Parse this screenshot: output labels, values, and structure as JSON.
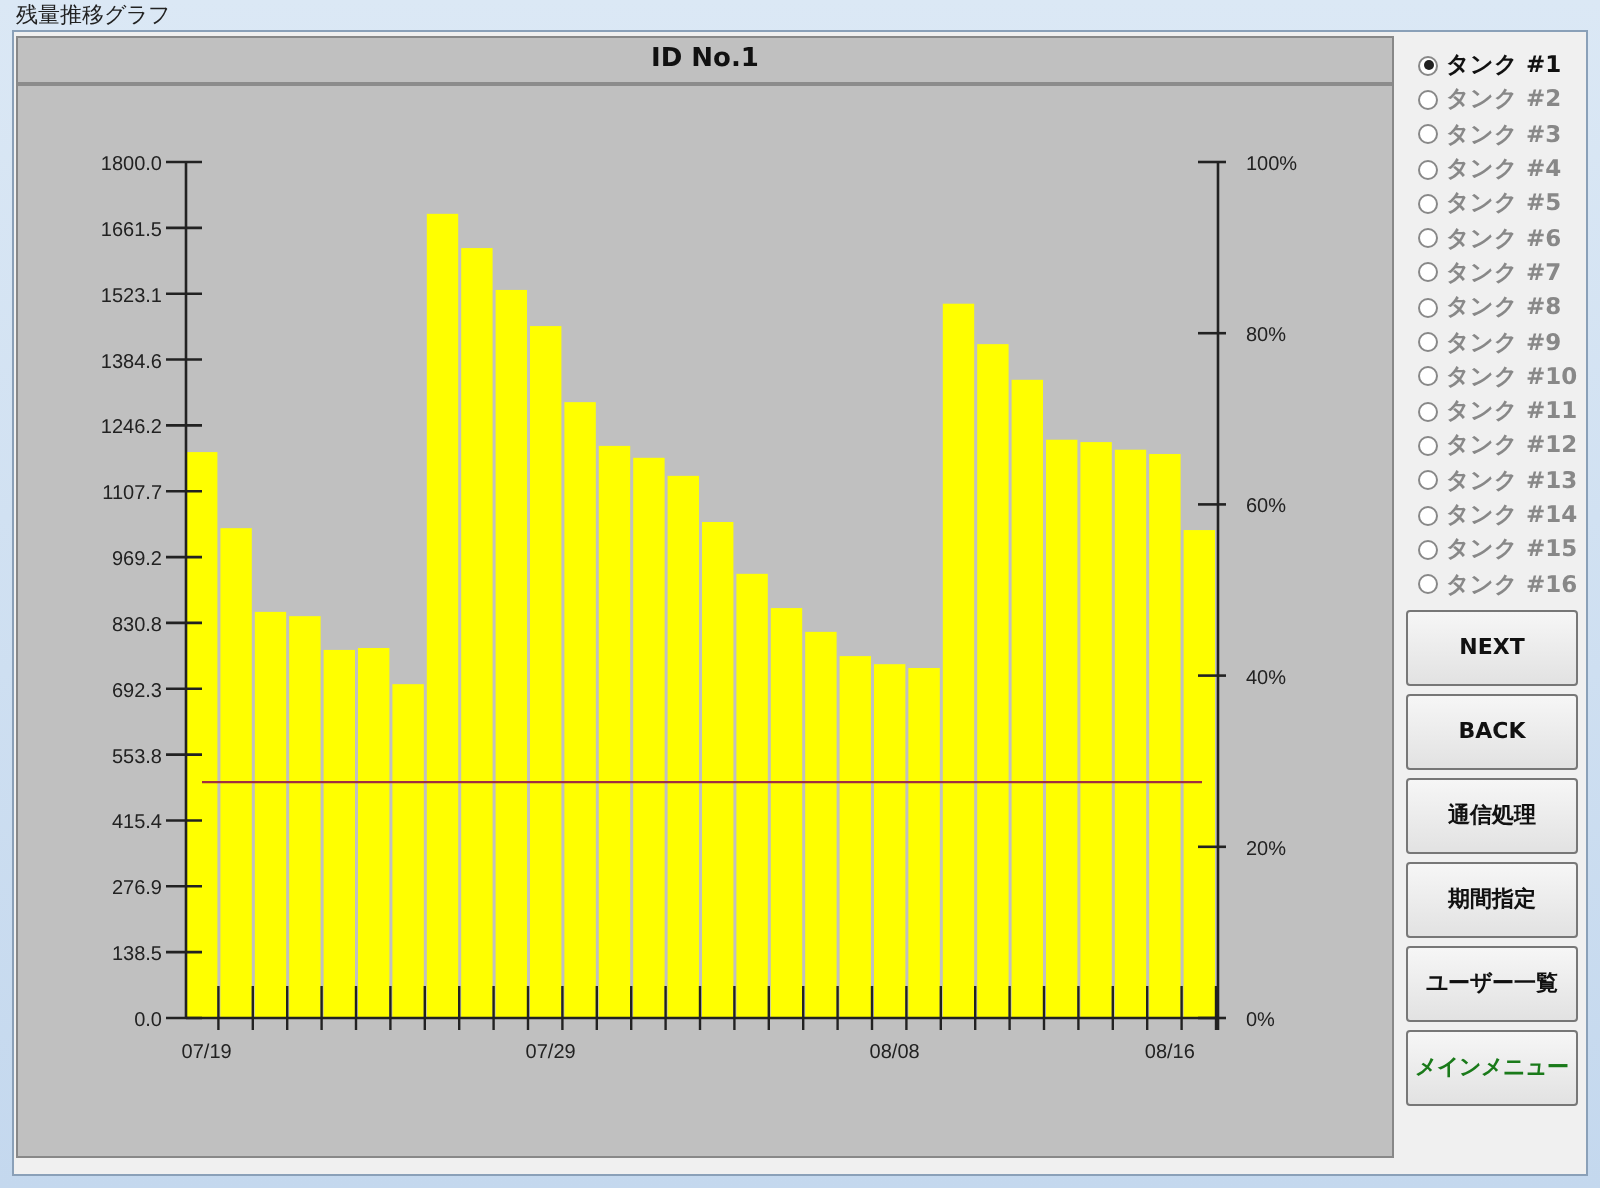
{
  "window": {
    "title": "残量推移グラフ"
  },
  "header": {
    "title": "ID No.1"
  },
  "chart": {
    "chart_data": {
      "type": "bar",
      "categories": [
        "07/19",
        null,
        null,
        null,
        null,
        null,
        null,
        null,
        null,
        null,
        "07/29",
        null,
        null,
        null,
        null,
        null,
        null,
        null,
        null,
        null,
        "08/08",
        null,
        null,
        null,
        null,
        null,
        null,
        null,
        "08/16",
        null
      ],
      "series": [
        {
          "color": "#ffff00",
          "values": [
            1190,
            1030,
            854,
            845,
            774,
            778,
            702,
            1691,
            1619,
            1531,
            1455,
            1295,
            1203,
            1178,
            1140,
            1043,
            934,
            862,
            812,
            761,
            744,
            736,
            1502,
            1417,
            1342,
            1216,
            1211,
            1195,
            1186,
            1026
          ]
        }
      ],
      "ylim": [
        0,
        1800
      ],
      "yticks": [
        {
          "value": 0,
          "label": "0.0"
        },
        {
          "value": 138.46,
          "label": "138.5"
        },
        {
          "value": 276.92,
          "label": "276.9"
        },
        {
          "value": 415.38,
          "label": "415.4"
        },
        {
          "value": 553.85,
          "label": "553.8"
        },
        {
          "value": 692.31,
          "label": "692.3"
        },
        {
          "value": 830.77,
          "label": "830.8"
        },
        {
          "value": 969.23,
          "label": "969.2"
        },
        {
          "value": 1107.69,
          "label": "1107.7"
        },
        {
          "value": 1246.15,
          "label": "1246.2"
        },
        {
          "value": 1384.62,
          "label": "1384.6"
        },
        {
          "value": 1523.08,
          "label": "1523.1"
        },
        {
          "value": 1661.54,
          "label": "1661.5"
        },
        {
          "value": 1800,
          "label": "1800.0"
        }
      ],
      "y2lim": [
        0,
        1
      ],
      "y2ticks": [
        {
          "value": 0,
          "label": "0%"
        },
        {
          "value": 0.2,
          "label": "20%"
        },
        {
          "value": 0.4,
          "label": "40%"
        },
        {
          "value": 0.6,
          "label": "60%"
        },
        {
          "value": 0.8,
          "label": "80%"
        },
        {
          "value": 1,
          "label": "100%"
        }
      ],
      "ref_lines": [
        {
          "axis": "y",
          "value": 496,
          "color": "#a03040"
        }
      ]
    }
  },
  "tanks": [
    {
      "label": "タンク #1",
      "selected": true
    },
    {
      "label": "タンク #2",
      "selected": false
    },
    {
      "label": "タンク #3",
      "selected": false
    },
    {
      "label": "タンク #4",
      "selected": false
    },
    {
      "label": "タンク #5",
      "selected": false
    },
    {
      "label": "タンク #6",
      "selected": false
    },
    {
      "label": "タンク #7",
      "selected": false
    },
    {
      "label": "タンク #8",
      "selected": false
    },
    {
      "label": "タンク #9",
      "selected": false
    },
    {
      "label": "タンク #10",
      "selected": false
    },
    {
      "label": "タンク #11",
      "selected": false
    },
    {
      "label": "タンク #12",
      "selected": false
    },
    {
      "label": "タンク #13",
      "selected": false
    },
    {
      "label": "タンク #14",
      "selected": false
    },
    {
      "label": "タンク #15",
      "selected": false
    },
    {
      "label": "タンク #16",
      "selected": false
    }
  ],
  "buttons": [
    {
      "label": "NEXT",
      "kind": "action"
    },
    {
      "label": "BACK",
      "kind": "action"
    },
    {
      "label": "通信処理",
      "kind": "action"
    },
    {
      "label": "期間指定",
      "kind": "action"
    },
    {
      "label": "ユーザー一覧",
      "kind": "action"
    },
    {
      "label": "メインメニュー",
      "kind": "menu"
    }
  ]
}
